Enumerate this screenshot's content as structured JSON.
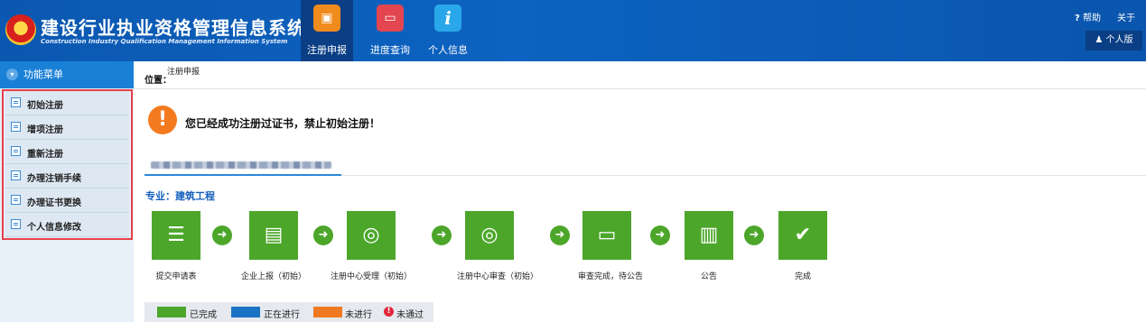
{
  "header": {
    "title": "建设行业执业资格管理信息系统",
    "subtitle": "Construction Industry Qualification Management Information System",
    "nav": [
      {
        "label": "注册申报",
        "icon": "registration-book-icon",
        "color": "#f08b1d",
        "glyph": "▣",
        "active": true
      },
      {
        "label": "进度查询",
        "icon": "monitor-icon",
        "color": "#e3464f",
        "glyph": "▭",
        "active": false
      },
      {
        "label": "个人信息",
        "icon": "info-icon",
        "color": "#2aa6ea",
        "glyph": "i",
        "active": false
      }
    ],
    "help_label": "帮助",
    "help_glyph": "?",
    "about_label": "关于",
    "version_label": "个人版",
    "version_glyph": "♟"
  },
  "sidebar": {
    "menu_title": "功能菜单",
    "menu_glyph": "▾",
    "items": [
      {
        "label": "初始注册"
      },
      {
        "label": "增项注册"
      },
      {
        "label": "重新注册"
      },
      {
        "label": "办理注销手续"
      },
      {
        "label": "办理证书更换"
      },
      {
        "label": "个人信息修改"
      }
    ],
    "highlight_color": "#e5414b"
  },
  "breadcrumb": {
    "label": "位置：",
    "value": "注册申报"
  },
  "main": {
    "warning_glyph": "!",
    "warning": "您已经成功注册过证书，禁止初始注册！",
    "specialty": "专业：建筑工程",
    "arrow_glyph": "➜",
    "steps": [
      {
        "label": "提交申请表",
        "icon": "submit-form-icon",
        "glyph": "☰",
        "status": "completed"
      },
      {
        "label": "企业上报（初始）",
        "icon": "folder-lock-icon",
        "glyph": "▤",
        "status": "completed"
      },
      {
        "label": "注册中心受理（初始）",
        "icon": "globe-search-icon",
        "glyph": "◎",
        "status": "completed"
      },
      {
        "label": "注册中心审查（初始）",
        "icon": "globe-search-icon",
        "glyph": "◎",
        "status": "completed"
      },
      {
        "label": "审查完成，待公告",
        "icon": "computer-user-icon",
        "glyph": "▭",
        "status": "completed"
      },
      {
        "label": "公告",
        "icon": "document-folder-icon",
        "glyph": "▥",
        "status": "completed"
      },
      {
        "label": "完成",
        "icon": "checkmark-icon",
        "glyph": "✔",
        "status": "completed"
      }
    ]
  },
  "legend": {
    "completed": {
      "label": "已完成",
      "color": "#4ca62a"
    },
    "in_progress": {
      "label": "正在进行",
      "color": "#1a73c4"
    },
    "not_started": {
      "label": "未进行",
      "color": "#f07a22"
    },
    "failed": {
      "label": "未通过",
      "color": "#e3263a",
      "glyph": "!"
    }
  }
}
